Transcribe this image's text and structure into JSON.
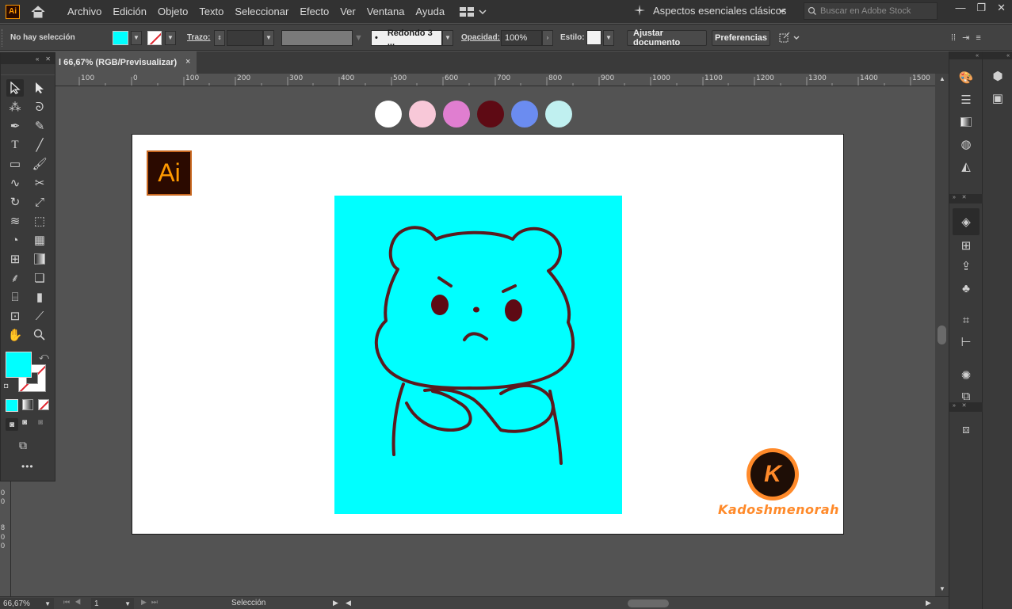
{
  "app": {
    "logo_text": "Ai",
    "menus": [
      "Archivo",
      "Edición",
      "Objeto",
      "Texto",
      "Seleccionar",
      "Efecto",
      "Ver",
      "Ventana",
      "Ayuda"
    ],
    "workspace": "Aspectos esenciales clásicos",
    "stock_placeholder": "Buscar en Adobe Stock"
  },
  "control": {
    "selection": "No hay selección",
    "trazo_label": "Trazo:",
    "brush": "Redondo 3 ...",
    "opacity_label": "Opacidad:",
    "opacity_value": "100%",
    "style_label": "Estilo:",
    "fit_button": "Ajustar documento",
    "prefs_button": "Preferencias",
    "fill_color": "#00ffff"
  },
  "document": {
    "tab_label": "l 66,67% (RGB/Previsualizar)",
    "close_glyph": "×"
  },
  "ruler": {
    "h_labels": [
      "100",
      "0",
      "100",
      "200",
      "300",
      "400",
      "500",
      "600",
      "700",
      "800",
      "900",
      "1000",
      "1100",
      "1200",
      "1300",
      "1400",
      "1500"
    ],
    "v_labels": [
      "0",
      "0",
      "8",
      "0",
      "0"
    ]
  },
  "canvas": {
    "palette": [
      "#ffffff",
      "#f8c8d8",
      "#e07ed0",
      "#5e0a14",
      "#6b8cf0",
      "#c0f0f0"
    ],
    "art_background": "#00ffff",
    "line_color": "#5a1a1e",
    "ai_badge": "Ai",
    "brand_letter": "K",
    "brand_name": "Kadoshmenorah"
  },
  "status": {
    "zoom": "66,67%",
    "page": "1",
    "tool": "Selección"
  }
}
